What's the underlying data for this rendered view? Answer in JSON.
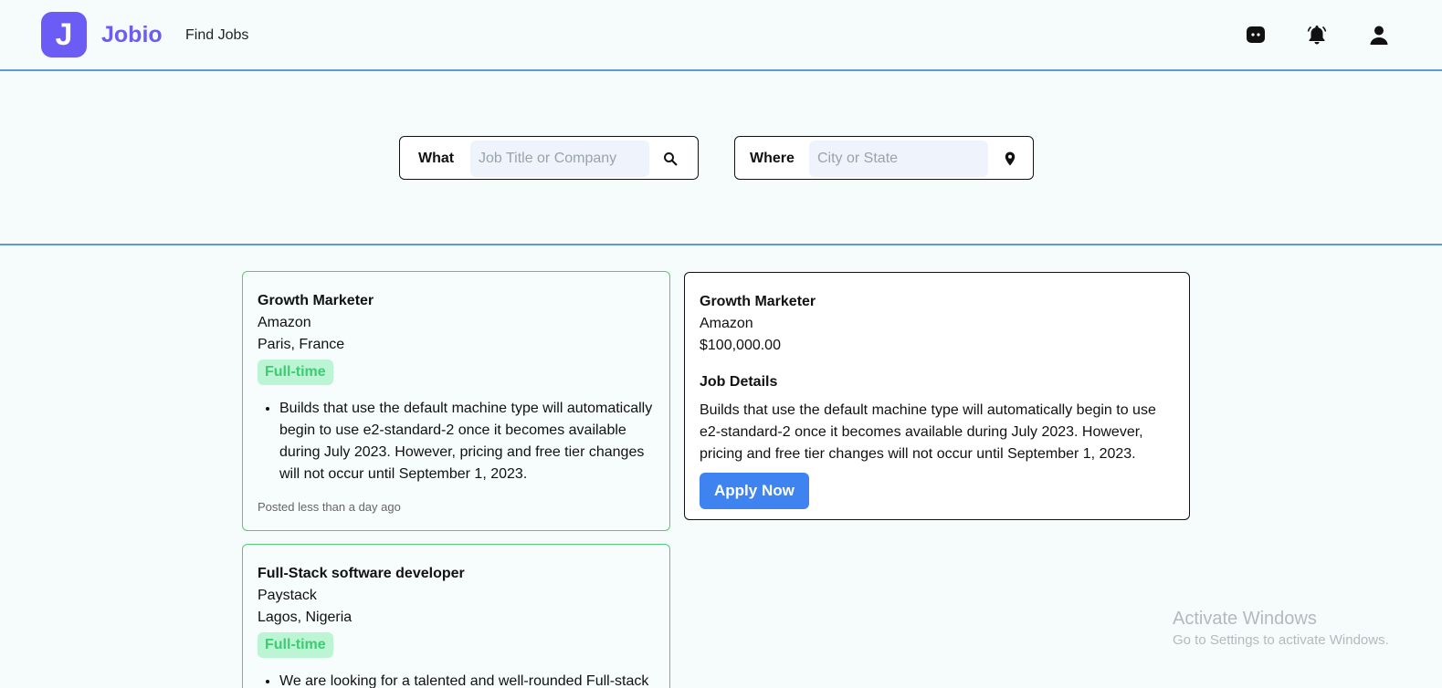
{
  "header": {
    "logo_letter": "J",
    "brand": "Jobio",
    "nav_find_jobs": "Find Jobs",
    "icons": [
      "chat-icon",
      "bell-icon",
      "user-icon"
    ]
  },
  "search": {
    "what_label": "What",
    "what_placeholder": "Job Title or Company",
    "where_label": "Where",
    "where_placeholder": "City or State"
  },
  "jobs": [
    {
      "title": "Growth Marketer",
      "company": "Amazon",
      "location": "Paris, France",
      "type": "Full-time",
      "description": "Builds that use the default machine type will automatically begin to use e2-standard-2 once it becomes available during July 2023. However, pricing and free tier changes will not occur until September 1, 2023.",
      "posted": "Posted less than a day ago"
    },
    {
      "title": "Full-Stack software developer",
      "company": "Paystack",
      "location": "Lagos, Nigeria",
      "type": "Full-time",
      "description": "We are looking for a talented and well-rounded Full-stack"
    }
  ],
  "detail": {
    "title": "Growth Marketer",
    "company": "Amazon",
    "salary": "$100,000.00",
    "details_heading": "Job Details",
    "description": "Builds that use the default machine type will automatically begin to use e2-standard-2 once it becomes available during July 2023. However, pricing and free tier changes will not occur until September 1, 2023.",
    "apply_label": "Apply Now"
  },
  "watermark": {
    "line1": "Activate Windows",
    "line2": "Go to Settings to activate Windows."
  },
  "colors": {
    "brand": "#6b5cf5",
    "accent_blue": "#3f83f0",
    "badge_bg": "#bbf5d3",
    "badge_text": "#3fcb74",
    "divider": "#5b9bd9"
  }
}
